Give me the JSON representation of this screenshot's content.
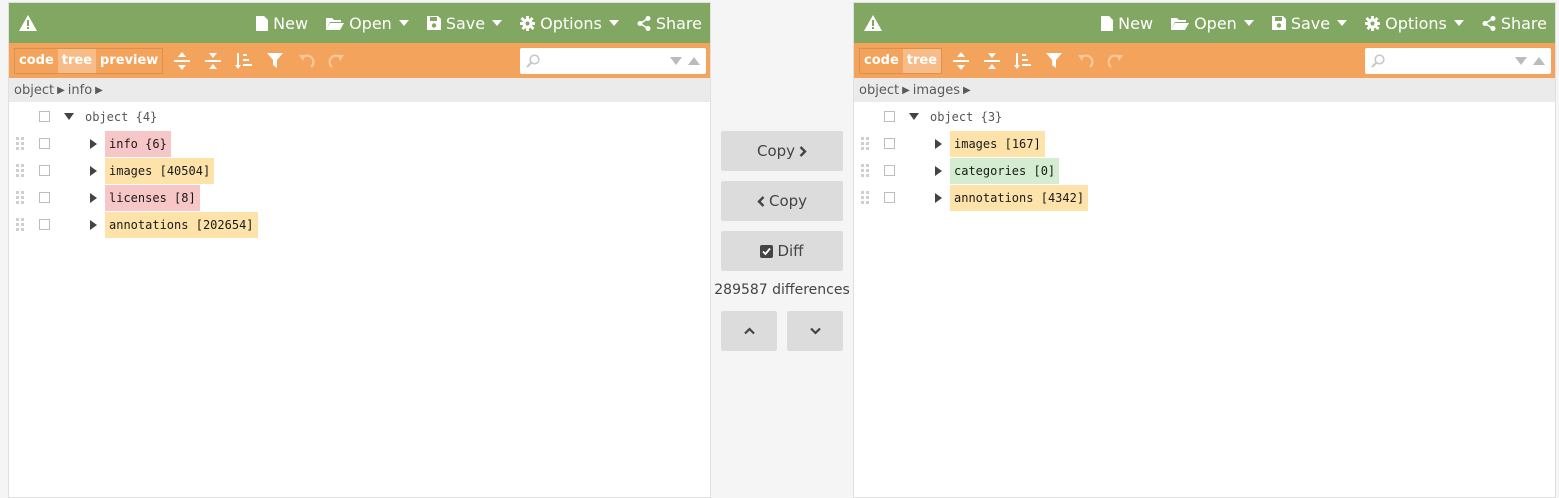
{
  "colors": {
    "topbar": "#82a763",
    "toolbar": "#f4a35c",
    "added": "#d4edd0",
    "removed": "#f7c6c6",
    "changed": "#fde3aa"
  },
  "menu": {
    "new": "New",
    "open": "Open",
    "save": "Save",
    "options": "Options",
    "share": "Share"
  },
  "modes": {
    "code": "code",
    "tree": "tree",
    "preview": "preview"
  },
  "left": {
    "mode_active": "tree",
    "breadcrumb": [
      "object",
      "info"
    ],
    "root": {
      "name": "object",
      "count": "{4}"
    },
    "nodes": [
      {
        "name": "info",
        "count": "{6}",
        "status": "removed"
      },
      {
        "name": "images",
        "count": "[40504]",
        "status": "changed"
      },
      {
        "name": "licenses",
        "count": "[8]",
        "status": "removed"
      },
      {
        "name": "annotations",
        "count": "[202654]",
        "status": "changed"
      }
    ]
  },
  "right": {
    "mode_active": "tree",
    "breadcrumb": [
      "object",
      "images"
    ],
    "root": {
      "name": "object",
      "count": "{3}"
    },
    "nodes": [
      {
        "name": "images",
        "count": "[167]",
        "status": "changed"
      },
      {
        "name": "categories",
        "count": "[0]",
        "status": "added"
      },
      {
        "name": "annotations",
        "count": "[4342]",
        "status": "changed"
      }
    ]
  },
  "middle": {
    "copy_right": "Copy",
    "copy_left": "Copy",
    "diff": "Diff",
    "diff_count": "289587 differences"
  }
}
